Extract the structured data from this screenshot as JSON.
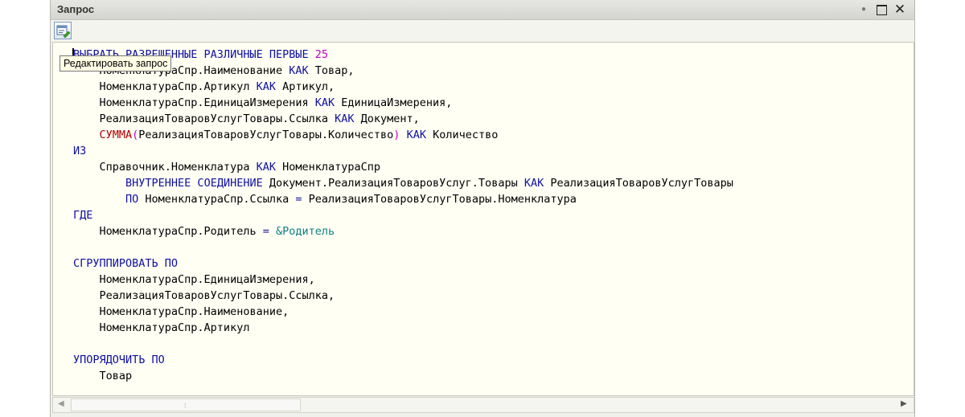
{
  "window": {
    "title": "Запрос"
  },
  "toolbar": {
    "edit_tooltip": "Редактировать запрос"
  },
  "icons": {
    "pin": "pin-icon",
    "maximize": "maximize-icon",
    "close": "close-icon",
    "edit": "edit-query-icon"
  },
  "colors": {
    "keyword": "#1010a0",
    "number": "#c000c0",
    "function": "#b00000",
    "parameter": "#108080",
    "editor_bg": "#fffff4"
  },
  "query": {
    "lines": [
      [
        {
          "t": "k",
          "v": "ВЫБРАТЬ РАЗРЕШЕННЫЕ РАЗЛИЧНЫЕ ПЕРВЫЕ "
        },
        {
          "t": "p",
          "v": "25"
        }
      ],
      [
        {
          "t": "n",
          "v": "    НоменклатураСпр.Наименование "
        },
        {
          "t": "k",
          "v": "КАК"
        },
        {
          "t": "n",
          "v": " Товар,"
        }
      ],
      [
        {
          "t": "n",
          "v": "    НоменклатураСпр.Артикул "
        },
        {
          "t": "k",
          "v": "КАК"
        },
        {
          "t": "n",
          "v": " Артикул,"
        }
      ],
      [
        {
          "t": "n",
          "v": "    НоменклатураСпр.ЕдиницаИзмерения "
        },
        {
          "t": "k",
          "v": "КАК"
        },
        {
          "t": "n",
          "v": " ЕдиницаИзмерения,"
        }
      ],
      [
        {
          "t": "n",
          "v": "    РеализацияТоваровУслугТовары.Ссылка "
        },
        {
          "t": "k",
          "v": "КАК"
        },
        {
          "t": "n",
          "v": " Документ,"
        }
      ],
      [
        {
          "t": "n",
          "v": "    "
        },
        {
          "t": "f",
          "v": "СУММА"
        },
        {
          "t": "o",
          "v": "("
        },
        {
          "t": "n",
          "v": "РеализацияТоваровУслугТовары.Количество"
        },
        {
          "t": "o",
          "v": ")"
        },
        {
          "t": "n",
          "v": " "
        },
        {
          "t": "k",
          "v": "КАК"
        },
        {
          "t": "n",
          "v": " Количество"
        }
      ],
      [
        {
          "t": "k",
          "v": "ИЗ"
        }
      ],
      [
        {
          "t": "n",
          "v": "    Справочник.Номенклатура "
        },
        {
          "t": "k",
          "v": "КАК"
        },
        {
          "t": "n",
          "v": " НоменклатураСпр"
        }
      ],
      [
        {
          "t": "n",
          "v": "        "
        },
        {
          "t": "k",
          "v": "ВНУТРЕННЕЕ СОЕДИНЕНИЕ"
        },
        {
          "t": "n",
          "v": " Документ.РеализацияТоваровУслуг.Товары "
        },
        {
          "t": "k",
          "v": "КАК"
        },
        {
          "t": "n",
          "v": " РеализацияТоваровУслугТовары"
        }
      ],
      [
        {
          "t": "n",
          "v": "        "
        },
        {
          "t": "k",
          "v": "ПО"
        },
        {
          "t": "n",
          "v": " НоменклатураСпр.Ссылка "
        },
        {
          "t": "k",
          "v": "="
        },
        {
          "t": "n",
          "v": " РеализацияТоваровУслугТовары.Номенклатура"
        }
      ],
      [
        {
          "t": "k",
          "v": "ГДЕ"
        }
      ],
      [
        {
          "t": "n",
          "v": "    НоменклатураСпр.Родитель "
        },
        {
          "t": "k",
          "v": "="
        },
        {
          "t": "n",
          "v": " "
        },
        {
          "t": "param",
          "v": "&Родитель"
        }
      ],
      [],
      [
        {
          "t": "k",
          "v": "СГРУППИРОВАТЬ ПО"
        }
      ],
      [
        {
          "t": "n",
          "v": "    НоменклатураСпр.ЕдиницаИзмерения,"
        }
      ],
      [
        {
          "t": "n",
          "v": "    РеализацияТоваровУслугТовары.Ссылка,"
        }
      ],
      [
        {
          "t": "n",
          "v": "    НоменклатураСпр.Наименование,"
        }
      ],
      [
        {
          "t": "n",
          "v": "    НоменклатураСпр.Артикул"
        }
      ],
      [],
      [
        {
          "t": "k",
          "v": "УПОРЯДОЧИТЬ ПО"
        }
      ],
      [
        {
          "t": "n",
          "v": "    Товар"
        }
      ]
    ]
  }
}
